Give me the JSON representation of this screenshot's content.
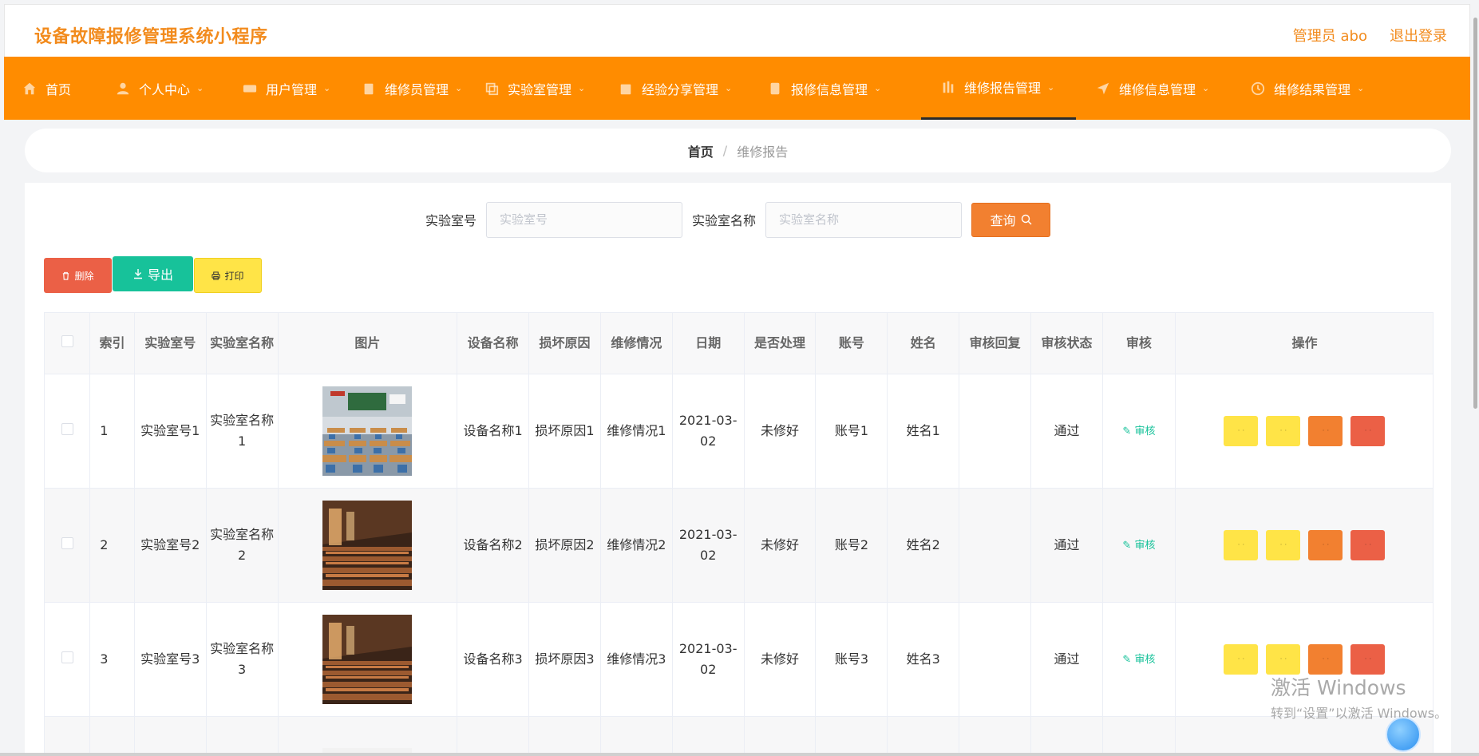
{
  "header": {
    "app_title": "设备故障报修管理系统小程序",
    "user_label": "管理员 abo",
    "logout_label": "退出登录"
  },
  "nav": {
    "items": [
      {
        "label": "首页",
        "icon": "home-icon",
        "has_dropdown": false,
        "active": false
      },
      {
        "label": "个人中心",
        "icon": "user-icon",
        "has_dropdown": true,
        "active": false
      },
      {
        "label": "用户管理",
        "icon": "users-icon",
        "has_dropdown": true,
        "active": false
      },
      {
        "label": "维修员管理",
        "icon": "clipboard-icon",
        "has_dropdown": true,
        "active": false
      },
      {
        "label": "实验室管理",
        "icon": "copy-icon",
        "has_dropdown": true,
        "active": false
      },
      {
        "label": "经验分享管理",
        "icon": "calendar-icon",
        "has_dropdown": true,
        "active": false
      },
      {
        "label": "报修信息管理",
        "icon": "folder-icon",
        "has_dropdown": true,
        "active": false
      },
      {
        "label": "维修报告管理",
        "icon": "bar-chart-icon",
        "has_dropdown": true,
        "active": true
      },
      {
        "label": "维修信息管理",
        "icon": "send-icon",
        "has_dropdown": true,
        "active": false
      },
      {
        "label": "维修结果管理",
        "icon": "clock-icon",
        "has_dropdown": true,
        "active": false
      }
    ]
  },
  "breadcrumb": {
    "home": "首页",
    "separator": "/",
    "current": "维修报告"
  },
  "search": {
    "lab_no_label": "实验室号",
    "lab_no_placeholder": "实验室号",
    "lab_name_label": "实验室名称",
    "lab_name_placeholder": "实验室名称",
    "button_label": "查询"
  },
  "actions": {
    "delete_label": "删除",
    "export_label": "导出",
    "print_label": "打印"
  },
  "table": {
    "columns": [
      "索引",
      "实验室号",
      "实验室名称",
      "图片",
      "设备名称",
      "损坏原因",
      "维修情况",
      "日期",
      "是否处理",
      "账号",
      "姓名",
      "审核回复",
      "审核状态",
      "审核",
      "操作"
    ],
    "rows": [
      {
        "index": "1",
        "lab_no": "实验室号1",
        "lab_name": "实验室名称1",
        "image": "classroom-photo",
        "device": "设备名称1",
        "reason": "损坏原因1",
        "repair": "维修情况1",
        "date": "2021-03-02",
        "handled": "未修好",
        "account": "账号1",
        "name": "姓名1",
        "reply": "",
        "status": "通过",
        "audit_label": "审核"
      },
      {
        "index": "2",
        "lab_no": "实验室号2",
        "lab_name": "实验室名称2",
        "image": "lecture-hall-photo",
        "device": "设备名称2",
        "reason": "损坏原因2",
        "repair": "维修情况2",
        "date": "2021-03-02",
        "handled": "未修好",
        "account": "账号2",
        "name": "姓名2",
        "reply": "",
        "status": "通过",
        "audit_label": "审核"
      },
      {
        "index": "3",
        "lab_no": "实验室号3",
        "lab_name": "实验室名称3",
        "image": "lecture-hall-photo",
        "device": "设备名称3",
        "reason": "损坏原因3",
        "repair": "维修情况3",
        "date": "2021-03-02",
        "handled": "未修好",
        "account": "账号3",
        "name": "姓名3",
        "reply": "",
        "status": "通过",
        "audit_label": "审核"
      }
    ]
  },
  "watermark": {
    "line1": "激活 Windows",
    "line2": "转到“设置”以激活 Windows。"
  },
  "colors": {
    "brand_orange": "#ff8c00",
    "title_orange": "#f28b1d",
    "delete_red": "#eb6046",
    "export_green": "#17c29a",
    "print_yellow": "#ffe447",
    "search_orange": "#f28030"
  }
}
